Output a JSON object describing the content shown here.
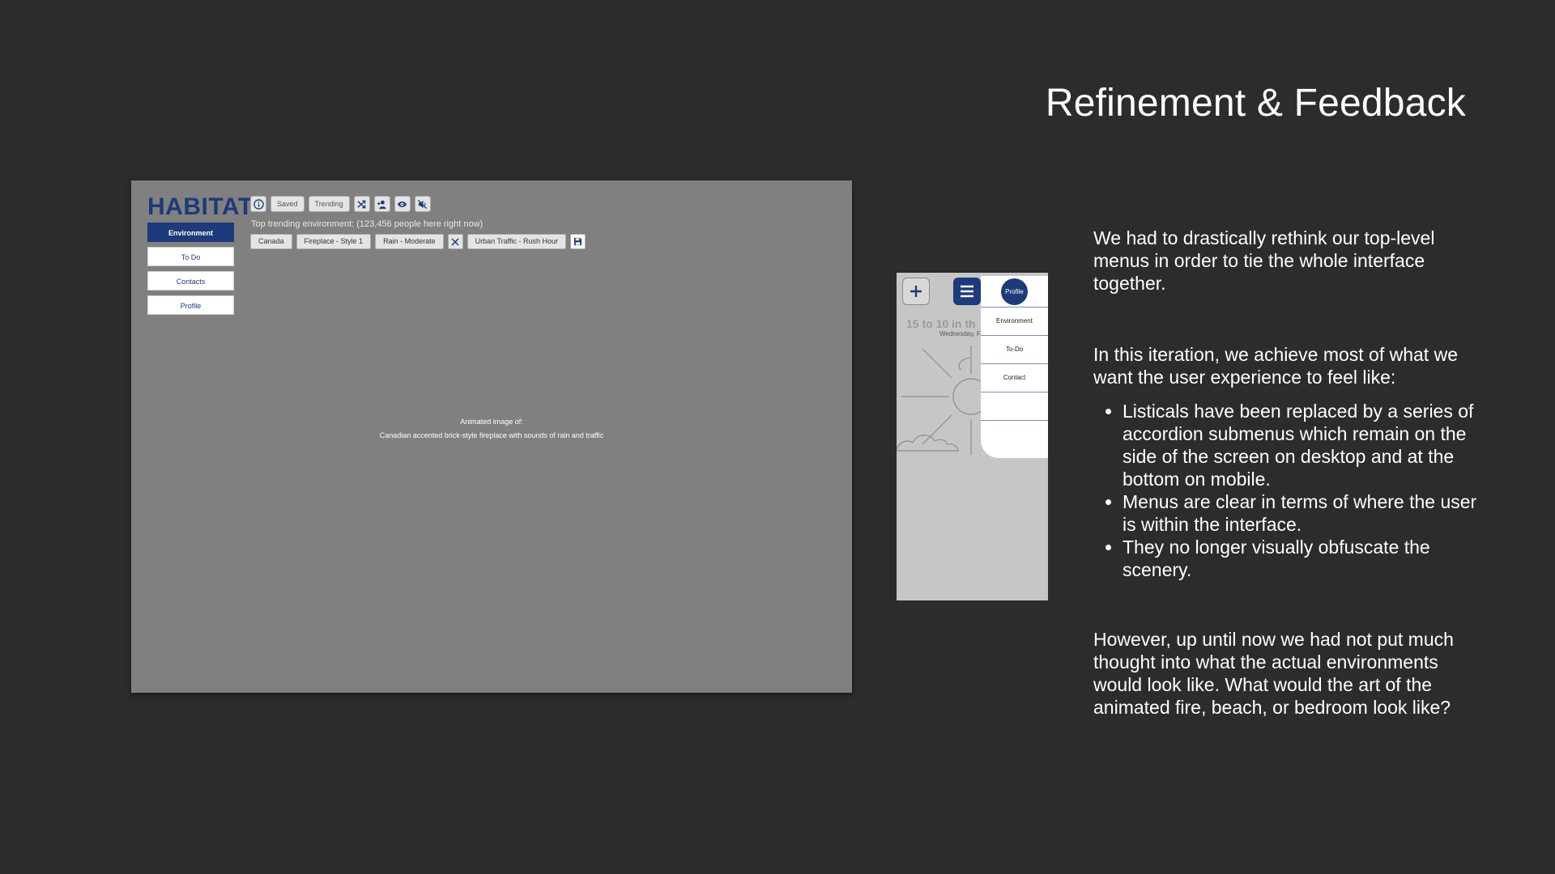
{
  "slide": {
    "title": "Refinement & Feedback",
    "paragraph_1": "We had to drastically rethink our top-level menus in order to tie the whole interface together.",
    "paragraph_2": "In this iteration, we achieve most of what we want the user experience to feel like:",
    "bullets": [
      "Listicals have been replaced by a series of accordion submenus which remain on the side of the screen on desktop and at the bottom on mobile.",
      "Menus are clear in terms of where the user is within the interface.",
      "They no longer visually obfuscate the scenery."
    ],
    "paragraph_3": "However, up until now we had not put much thought into what the actual environments would look like. What would the art of the animated fire, beach, or bedroom look like?"
  },
  "desktop": {
    "logo": "HABITAT",
    "side_menu": [
      "Environment",
      "To Do",
      "Contacts",
      "Profile"
    ],
    "toolbar": {
      "info_icon": "info-icon",
      "saved": "Saved",
      "trending": "Trending",
      "icons": [
        "shuffle-icon",
        "add-user-icon",
        "eye-icon",
        "mute-icon"
      ]
    },
    "trending_text": "Top trending environment: (123,456 people here right now)",
    "chips": [
      "Canada",
      "Fireplace - Style 1",
      "Rain - Moderate",
      "Urban Traffic - Rush Hour"
    ],
    "animation_caption_1": "Animated image of:",
    "animation_caption_2": "Canadian accented brick-style fireplace with sounds of rain and traffic"
  },
  "mobile": {
    "headline": "15 to 10 in th",
    "subline": "Wednesday, F",
    "profile": "Profile",
    "menu_items": [
      "Environment",
      "To-Do",
      "Contact"
    ]
  },
  "colors": {
    "background": "#2c2c2c",
    "brand_blue": "#1d3a7a",
    "desktop_bg": "#808080",
    "mobile_bg": "#c6c6c6"
  }
}
